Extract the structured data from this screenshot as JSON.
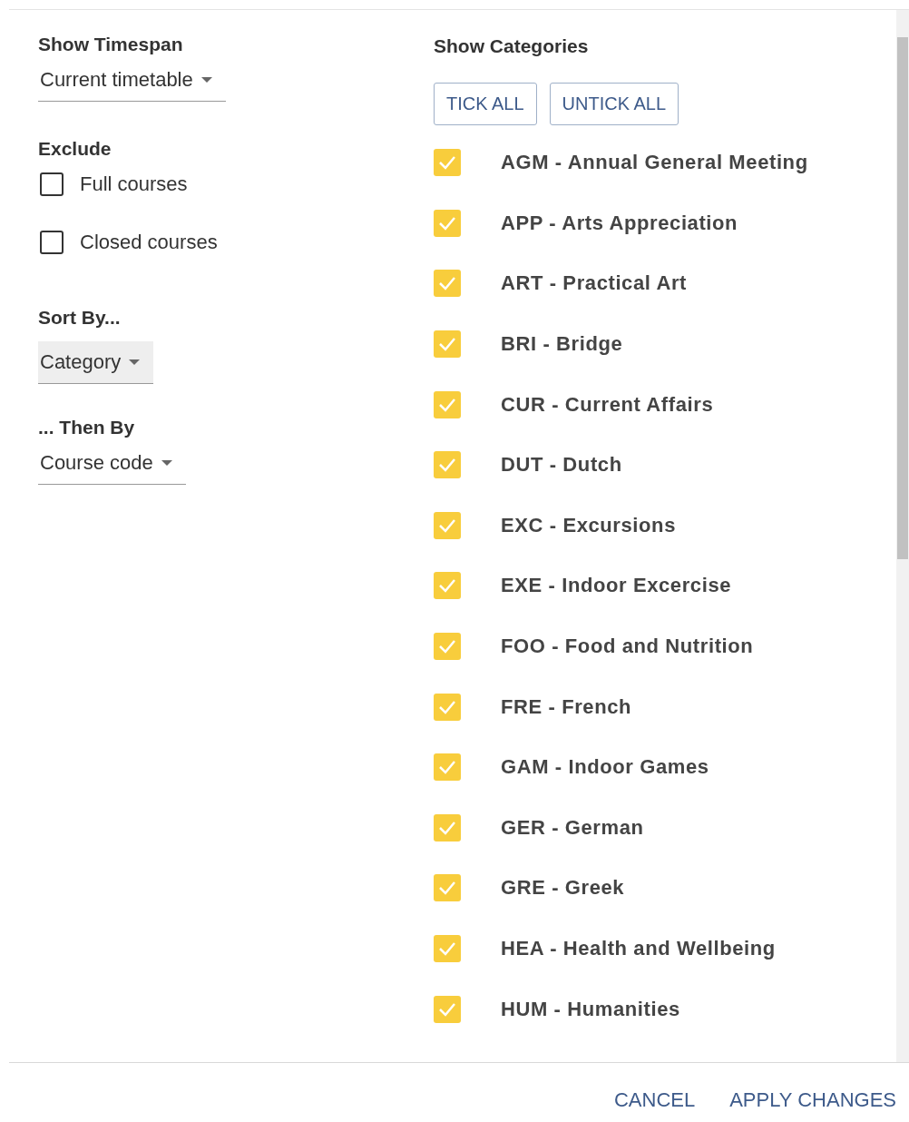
{
  "timespan": {
    "label": "Show Timespan",
    "value": "Current timetable",
    "focused": false
  },
  "exclude": {
    "label": "Exclude",
    "options": [
      {
        "label": "Full courses",
        "checked": false
      },
      {
        "label": "Closed courses",
        "checked": false
      }
    ]
  },
  "sort_by": {
    "label": "Sort By...",
    "value": "Category",
    "focused": true
  },
  "then_by": {
    "label": "... Then By",
    "value": "Course code",
    "focused": false
  },
  "categories": {
    "label": "Show Categories",
    "buttons": [
      "TICK ALL",
      "UNTICK ALL"
    ],
    "items": [
      {
        "label": "AGM - Annual General Meeting",
        "checked": true
      },
      {
        "label": "APP - Arts Appreciation",
        "checked": true
      },
      {
        "label": "ART - Practical Art",
        "checked": true
      },
      {
        "label": "BRI - Bridge",
        "checked": true
      },
      {
        "label": "CUR - Current Affairs",
        "checked": true
      },
      {
        "label": "DUT - Dutch",
        "checked": true
      },
      {
        "label": "EXC - Excursions",
        "checked": true
      },
      {
        "label": "EXE - Indoor Excercise",
        "checked": true
      },
      {
        "label": "FOO - Food and Nutrition",
        "checked": true
      },
      {
        "label": "FRE - French",
        "checked": true
      },
      {
        "label": "GAM - Indoor Games",
        "checked": true
      },
      {
        "label": "GER - German",
        "checked": true
      },
      {
        "label": "GRE - Greek",
        "checked": true
      },
      {
        "label": "HEA - Health and Wellbeing",
        "checked": true
      },
      {
        "label": "HUM - Humanities",
        "checked": true
      }
    ]
  },
  "footer": {
    "buttons": [
      "CANCEL",
      "APPLY CHANGES"
    ]
  }
}
